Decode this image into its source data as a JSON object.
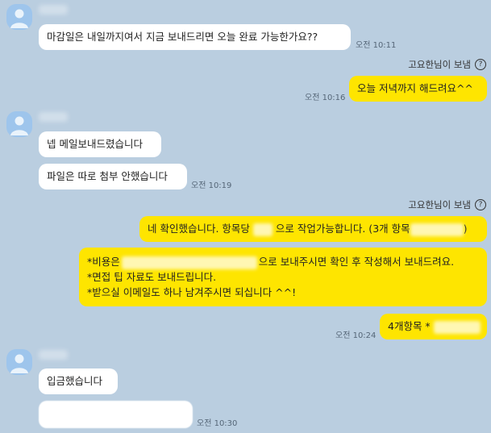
{
  "chat": {
    "header1": {
      "avatar": "user-avatar-icon"
    },
    "m1": {
      "text": "마감일은 내일까지여서 지금 보내드리면 오늘 완료 가능한가요??",
      "time": "오전 10:11"
    },
    "read1": {
      "label": "고요한님이 보냄"
    },
    "m2": {
      "text": "오늘 저녁까지 해드려요^^",
      "time": "오전 10:16"
    },
    "m3": {
      "text": "넵 메일보내드렸습니다"
    },
    "m4": {
      "text": "파일은 따로 첨부 안했습니다",
      "time": "오전 10:19"
    },
    "read2": {
      "label": "고요한님이 보냄"
    },
    "m5": {
      "part1": "네 확인했습니다. 항목당",
      "part2": "으로 작업가능합니다. (3개 항목",
      "part3": ")"
    },
    "m6": {
      "line1a": "*비용은",
      "line1b": "으로 보내주시면 확인 후 작성해서 보내드려요.",
      "line2": "*면접 팁 자료도 보내드립니다.",
      "line3": "*받으실 이메일도 하나 남겨주시면 되십니다 ^^!"
    },
    "m7": {
      "text": "4개항목 *",
      "time": "오전 10:24"
    },
    "m8": {
      "text": "입금했습니다"
    },
    "m9": {
      "time": "오전 10:30"
    }
  },
  "colors": {
    "background": "#bacee0",
    "incoming_bubble": "#ffffff",
    "outgoing_bubble": "#fee500",
    "avatar": "#9ec5ec"
  }
}
